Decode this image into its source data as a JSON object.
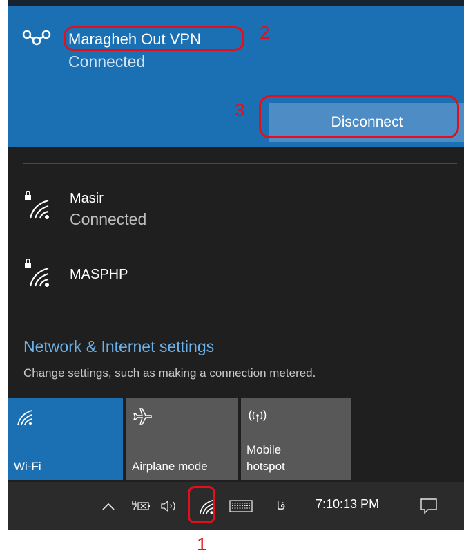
{
  "vpn": {
    "name": "Maragheh Out VPN",
    "status": "Connected",
    "disconnect_label": "Disconnect"
  },
  "networks": [
    {
      "name": "Masir",
      "status": "Connected"
    },
    {
      "name": "MASPHP",
      "status": ""
    }
  ],
  "settings": {
    "link": "Network & Internet settings",
    "description": "Change settings, such as making a connection metered."
  },
  "tiles": {
    "wifi": "Wi-Fi",
    "airplane": "Airplane mode",
    "hotspot_line1": "Mobile",
    "hotspot_line2": "hotspot"
  },
  "taskbar": {
    "time": "7:10:13 PM",
    "language": "فا"
  },
  "annotations": {
    "n1": "1",
    "n2": "2",
    "n3": "3"
  },
  "colors": {
    "accent_blue": "#1b6fb3",
    "panel_bg": "#1f1f1f",
    "annotation_red": "#e3101b"
  }
}
